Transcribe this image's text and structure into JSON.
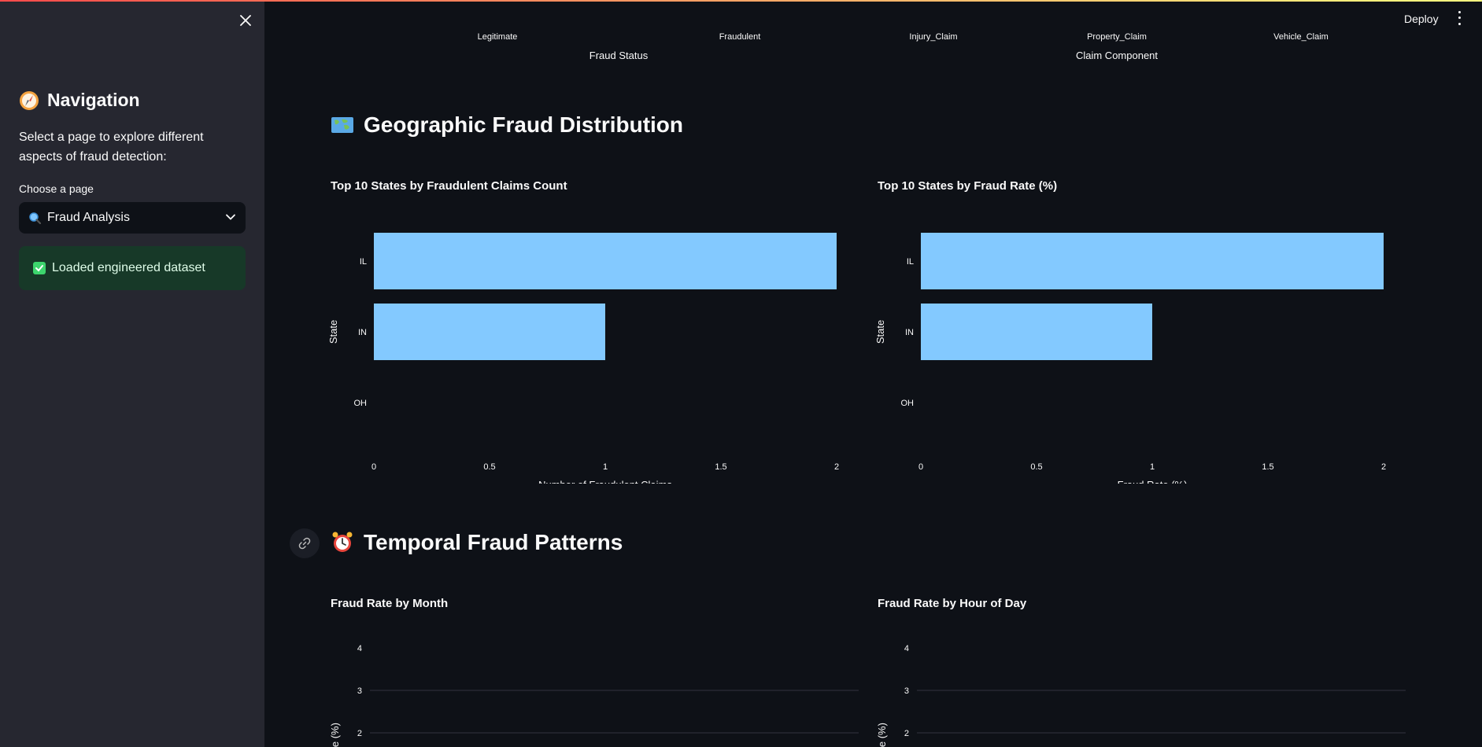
{
  "sidebar": {
    "title": "Navigation",
    "title_icon": "compass-icon",
    "description": "Select a page to explore different aspects of fraud detection:",
    "select_label": "Choose a page",
    "select_value": "Fraud Analysis",
    "select_icon": "magnifier-icon",
    "success_message": "Loaded engineered dataset"
  },
  "header": {
    "deploy_label": "Deploy"
  },
  "previous_chart": {
    "left_categories": [
      "Legitimate",
      "Fraudulent"
    ],
    "left_xlabel": "Fraud Status",
    "right_categories": [
      "Injury_Claim",
      "Property_Claim",
      "Vehicle_Claim"
    ],
    "right_xlabel": "Claim Component"
  },
  "sections": {
    "geo_title": "Geographic Fraud Distribution",
    "geo_icon": "world-map-icon",
    "temporal_title": "Temporal Fraud Patterns",
    "temporal_icon": "alarm-clock-icon"
  },
  "colors": {
    "bar": "#83c9ff",
    "background": "#0e1117",
    "sidebar": "#262730",
    "grid": "#31333f"
  },
  "chart_data": [
    {
      "type": "bar",
      "orientation": "horizontal",
      "title": "Top 10 States by Fraudulent Claims Count",
      "categories": [
        "IL",
        "IN",
        "OH"
      ],
      "values": [
        2,
        1,
        0
      ],
      "xlabel": "Number of Fraudulent Claims",
      "ylabel": "State",
      "xlim": [
        0,
        2
      ],
      "xticks": [
        "0",
        "0.5",
        "1",
        "1.5",
        "2"
      ]
    },
    {
      "type": "bar",
      "orientation": "horizontal",
      "title": "Top 10 States by Fraud Rate (%)",
      "categories": [
        "IL",
        "IN",
        "OH"
      ],
      "values": [
        2,
        1,
        0
      ],
      "xlabel": "Fraud Rate (%)",
      "ylabel": "State",
      "xlim": [
        0,
        2
      ],
      "xticks": [
        "0",
        "0.5",
        "1",
        "1.5",
        "2"
      ]
    },
    {
      "type": "line",
      "title": "Fraud Rate by Month",
      "ylabel": "ate (%)",
      "yticks": [
        "4",
        "3",
        "2"
      ],
      "grid": true
    },
    {
      "type": "line",
      "title": "Fraud Rate by Hour of Day",
      "ylabel": "ate (%)",
      "yticks": [
        "4",
        "3",
        "2"
      ],
      "grid": true
    }
  ]
}
